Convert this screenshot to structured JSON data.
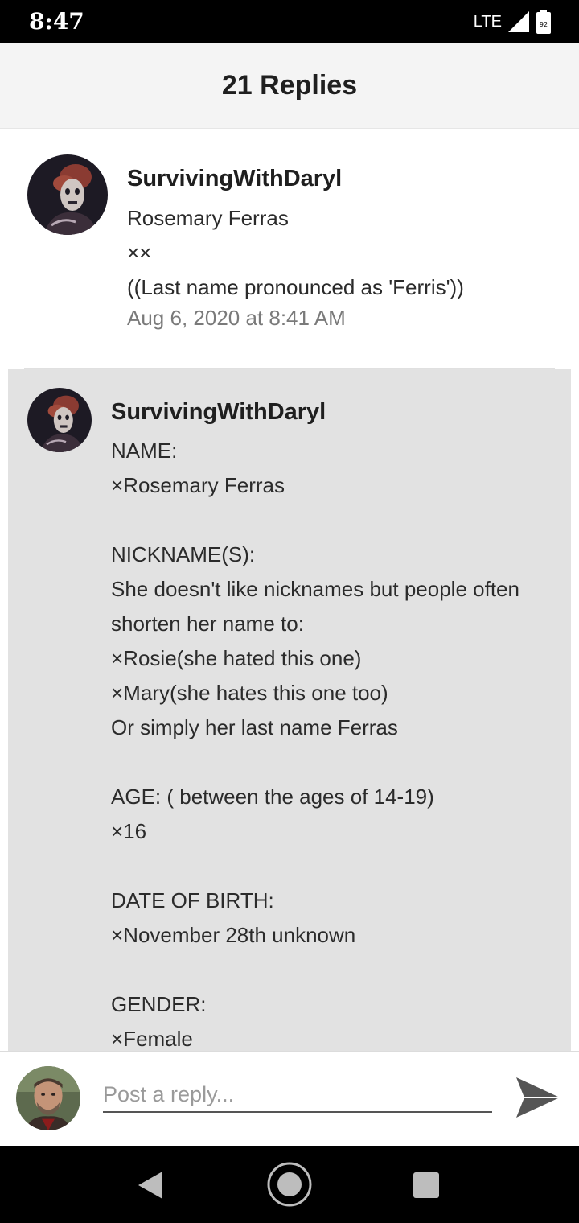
{
  "status_bar": {
    "time": "8:47",
    "network": "LTE",
    "battery_level": "92",
    "icons": [
      "signal-icon",
      "battery-icon"
    ]
  },
  "header": {
    "title": "21 Replies"
  },
  "replies": [
    {
      "username": "SurvivingWithDaryl",
      "lines": [
        "Rosemary Ferras",
        "××",
        "((Last name pronounced as 'Ferris'))"
      ],
      "timestamp": "Aug 6, 2020 at 8:41 AM"
    },
    {
      "username": "SurvivingWithDaryl",
      "lines": [
        "NAME:",
        "×Rosemary Ferras",
        "",
        "NICKNAME(S):",
        "She doesn't like nicknames but people often",
        "shorten her name to:",
        "×Rosie(she hated this one)",
        "×Mary(she hates this one too)",
        "Or simply her last name Ferras",
        "",
        "AGE: ( between the ages of 14-19)",
        "×16",
        "",
        "DATE OF BIRTH:",
        "×November 28th unknown",
        "",
        "GENDER:",
        "×Female"
      ],
      "highlighted": true
    }
  ],
  "compose": {
    "placeholder": "Post a reply...",
    "value": ""
  },
  "nav_bar": {
    "icons": [
      "back-icon",
      "home-icon",
      "recents-icon"
    ]
  },
  "colors": {
    "highlight_background": "#e2e2e2",
    "header_background": "#f4f4f4"
  }
}
